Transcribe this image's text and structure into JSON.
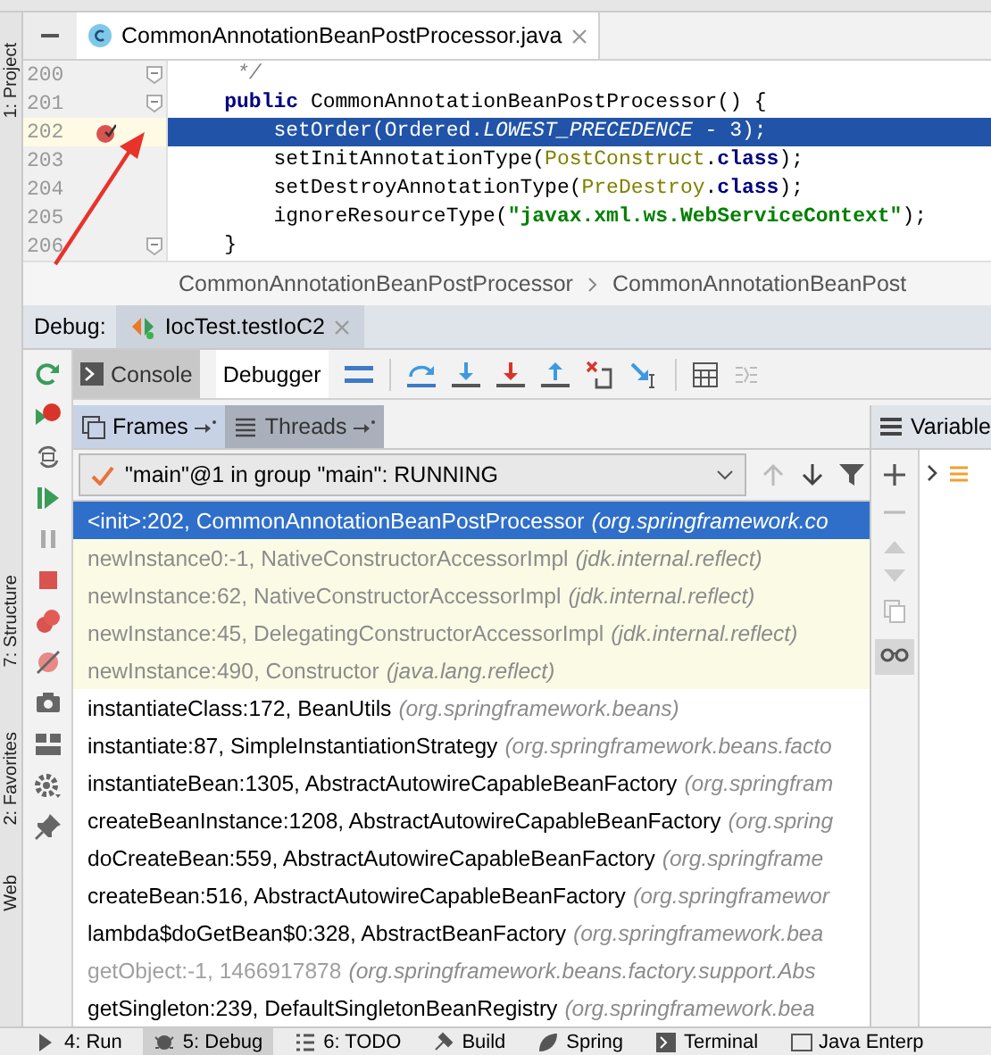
{
  "side_strip": [
    {
      "label": "1: Project"
    },
    {
      "label": "7: Structure"
    },
    {
      "label": "2: Favorites"
    },
    {
      "label": "Web"
    }
  ],
  "editor": {
    "tab": {
      "title": "CommonAnnotationBeanPostProcessor.java",
      "selected": true
    },
    "lines": [
      {
        "number": "200",
        "current": false,
        "breakpoint": false,
        "fold": true,
        "kind": "comment_end",
        "tokens": [
          {
            "kind": "comment",
            "text": "*/"
          }
        ]
      },
      {
        "number": "201",
        "current": false,
        "breakpoint": false,
        "fold": true,
        "kind": "member",
        "tokens": [
          {
            "kind": "keyword",
            "text": "public"
          },
          {
            "kind": "plain",
            "text": " CommonAnnotationBeanPostProcessor() {"
          }
        ]
      },
      {
        "number": "202",
        "current": true,
        "breakpoint": true,
        "fold": false,
        "kind": "statement",
        "tokens": [
          {
            "kind": "plain",
            "text": "setOrder(Ordered."
          },
          {
            "kind": "static",
            "text": "LOWEST_PRECEDENCE"
          },
          {
            "kind": "plain",
            "text": " - 3);"
          }
        ]
      },
      {
        "number": "203",
        "current": false,
        "breakpoint": false,
        "fold": false,
        "kind": "statement",
        "tokens": [
          {
            "kind": "plain",
            "text": "setInitAnnotationType("
          },
          {
            "kind": "type",
            "text": "PostConstruct"
          },
          {
            "kind": "plain",
            "text": "."
          },
          {
            "kind": "keyword",
            "text": "class"
          },
          {
            "kind": "plain",
            "text": ");"
          }
        ]
      },
      {
        "number": "204",
        "current": false,
        "breakpoint": false,
        "fold": false,
        "kind": "statement",
        "tokens": [
          {
            "kind": "plain",
            "text": "setDestroyAnnotationType("
          },
          {
            "kind": "type",
            "text": "PreDestroy"
          },
          {
            "kind": "plain",
            "text": "."
          },
          {
            "kind": "keyword",
            "text": "class"
          },
          {
            "kind": "plain",
            "text": ");"
          }
        ]
      },
      {
        "number": "205",
        "current": false,
        "breakpoint": false,
        "fold": false,
        "kind": "statement",
        "tokens": [
          {
            "kind": "plain",
            "text": "ignoreResourceType("
          },
          {
            "kind": "string",
            "text": "\"javax.xml.ws.WebServiceContext\""
          },
          {
            "kind": "plain",
            "text": ");"
          }
        ]
      },
      {
        "number": "206",
        "current": false,
        "breakpoint": false,
        "fold": true,
        "kind": "member",
        "tokens": [
          {
            "kind": "plain",
            "text": "}"
          }
        ]
      }
    ],
    "breadcrumbs": [
      "CommonAnnotationBeanPostProcessor",
      "CommonAnnotationBeanPost"
    ]
  },
  "debug": {
    "label": "Debug:",
    "session_tab": {
      "title": "IocTest.testIoC2",
      "selected": true
    },
    "view_tabs": [
      {
        "label": "Console",
        "selected": false
      },
      {
        "label": "Debugger",
        "selected": true
      }
    ],
    "panel_tabs": [
      {
        "label": "Frames",
        "selected": true
      },
      {
        "label": "Threads",
        "selected": false
      }
    ],
    "thread_selector": {
      "value": "\"main\"@1 in group \"main\": RUNNING"
    },
    "frames": [
      {
        "method": "<init>:202, CommonAnnotationBeanPostProcessor",
        "package": "(org.springframework.co",
        "kind": "normal",
        "selected": true
      },
      {
        "method": "newInstance0:-1, NativeConstructorAccessorImpl",
        "package": "(jdk.internal.reflect)",
        "kind": "library",
        "selected": false
      },
      {
        "method": "newInstance:62, NativeConstructorAccessorImpl",
        "package": "(jdk.internal.reflect)",
        "kind": "library",
        "selected": false
      },
      {
        "method": "newInstance:45, DelegatingConstructorAccessorImpl",
        "package": "(jdk.internal.reflect)",
        "kind": "library",
        "selected": false
      },
      {
        "method": "newInstance:490, Constructor",
        "package": "(java.lang.reflect)",
        "kind": "library",
        "selected": false
      },
      {
        "method": "instantiateClass:172, BeanUtils",
        "package": "(org.springframework.beans)",
        "kind": "normal",
        "selected": false
      },
      {
        "method": "instantiate:87, SimpleInstantiationStrategy",
        "package": "(org.springframework.beans.facto",
        "kind": "normal",
        "selected": false
      },
      {
        "method": "instantiateBean:1305, AbstractAutowireCapableBeanFactory",
        "package": "(org.springfram",
        "kind": "normal",
        "selected": false
      },
      {
        "method": "createBeanInstance:1208, AbstractAutowireCapableBeanFactory",
        "package": "(org.spring",
        "kind": "normal",
        "selected": false
      },
      {
        "method": "doCreateBean:559, AbstractAutowireCapableBeanFactory",
        "package": "(org.springframe",
        "kind": "normal",
        "selected": false
      },
      {
        "method": "createBean:516, AbstractAutowireCapableBeanFactory",
        "package": "(org.springframewor",
        "kind": "normal",
        "selected": false
      },
      {
        "method": "lambda$doGetBean$0:328, AbstractBeanFactory",
        "package": "(org.springframework.bea",
        "kind": "normal",
        "selected": false
      },
      {
        "method": "getObject:-1, 1466917878",
        "package": "(org.springframework.beans.factory.support.Abs",
        "kind": "hidden",
        "selected": false
      },
      {
        "method": "getSingleton:239, DefaultSingletonBeanRegistry",
        "package": "(org.springframework.bea",
        "kind": "normal",
        "selected": false
      }
    ],
    "variables": {
      "title": "Variable"
    }
  },
  "bottom_bar": [
    {
      "label": "4: Run",
      "selected": false
    },
    {
      "label": "5: Debug",
      "selected": true
    },
    {
      "label": "6: TODO",
      "selected": false
    },
    {
      "label": "Build",
      "selected": false
    },
    {
      "label": "Spring",
      "selected": false
    },
    {
      "label": "Terminal",
      "selected": false
    },
    {
      "label": "Java Enterp",
      "selected": false
    }
  ]
}
